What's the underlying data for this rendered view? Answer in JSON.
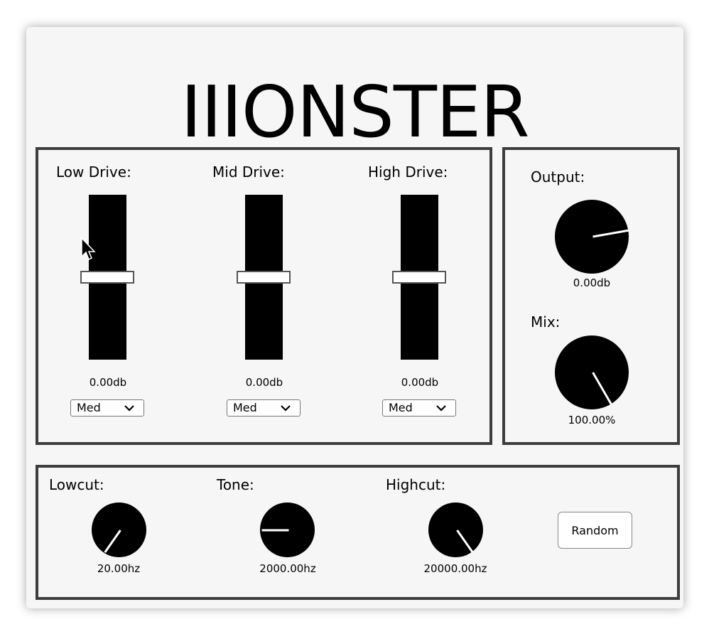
{
  "app": {
    "title": "IIIONSTER"
  },
  "drive_section": {
    "bands": [
      {
        "label": "Low Drive:",
        "value": "0.00db",
        "mode": "Med",
        "level": 0.5
      },
      {
        "label": "Mid Drive:",
        "value": "0.00db",
        "mode": "Med",
        "level": 0.5
      },
      {
        "label": "High Drive:",
        "value": "0.00db",
        "mode": "Med",
        "level": 0.5
      }
    ]
  },
  "output_section": {
    "output": {
      "label": "Output:",
      "value": "0.00db"
    },
    "mix": {
      "label": "Mix:",
      "value": "100.00%"
    }
  },
  "filter_section": {
    "lowcut": {
      "label": "Lowcut:",
      "value": "20.00hz"
    },
    "tone": {
      "label": "Tone:",
      "value": "2000.00hz"
    },
    "highcut": {
      "label": "Highcut:",
      "value": "20000.00hz"
    },
    "random_label": "Random"
  }
}
